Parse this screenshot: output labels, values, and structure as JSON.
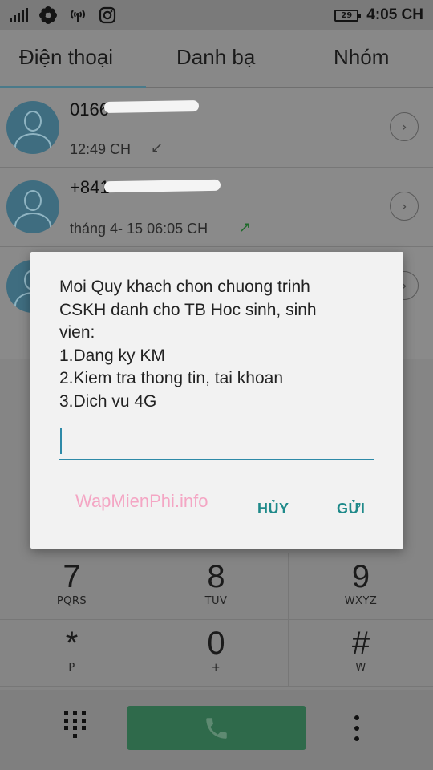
{
  "status_bar": {
    "battery": "29",
    "time": "4:05 CH",
    "icons": [
      "signal-icon",
      "flower-icon",
      "wifi-hotspot-icon",
      "instagram-icon",
      "battery-icon"
    ]
  },
  "tabs": [
    {
      "label": "Điện thoại",
      "active": true
    },
    {
      "label": "Danh bạ",
      "active": false
    },
    {
      "label": "Nhóm",
      "active": false
    }
  ],
  "calls": [
    {
      "number": "0166",
      "time": "12:49 CH",
      "direction": "incoming"
    },
    {
      "number": "+841",
      "time": "tháng 4- 15 06:05 CH",
      "direction": "outgoing"
    }
  ],
  "dialog": {
    "message_lines": [
      "Moi Quy khach chon chuong trinh",
      "CSKH danh cho TB Hoc sinh, sinh",
      "vien:",
      "1.Dang ky KM",
      "2.Kiem tra thong tin, tai khoan",
      "3.Dich vu 4G"
    ],
    "input_value": "",
    "cancel_label": "HỦY",
    "send_label": "GỬI"
  },
  "watermark": "WapMienPhi.info",
  "dialpad": {
    "keys": [
      {
        "digit": "7",
        "letters": "PQRS"
      },
      {
        "digit": "8",
        "letters": "TUV"
      },
      {
        "digit": "9",
        "letters": "WXYZ"
      },
      {
        "digit": "*",
        "letters": "P"
      },
      {
        "digit": "0",
        "letters": "+"
      },
      {
        "digit": "#",
        "letters": "W"
      }
    ]
  },
  "colors": {
    "accent": "#2e8aa8",
    "dialog_button": "#1f8a8a",
    "call_button": "#2f6a4b",
    "watermark": "#f4a6c4"
  }
}
